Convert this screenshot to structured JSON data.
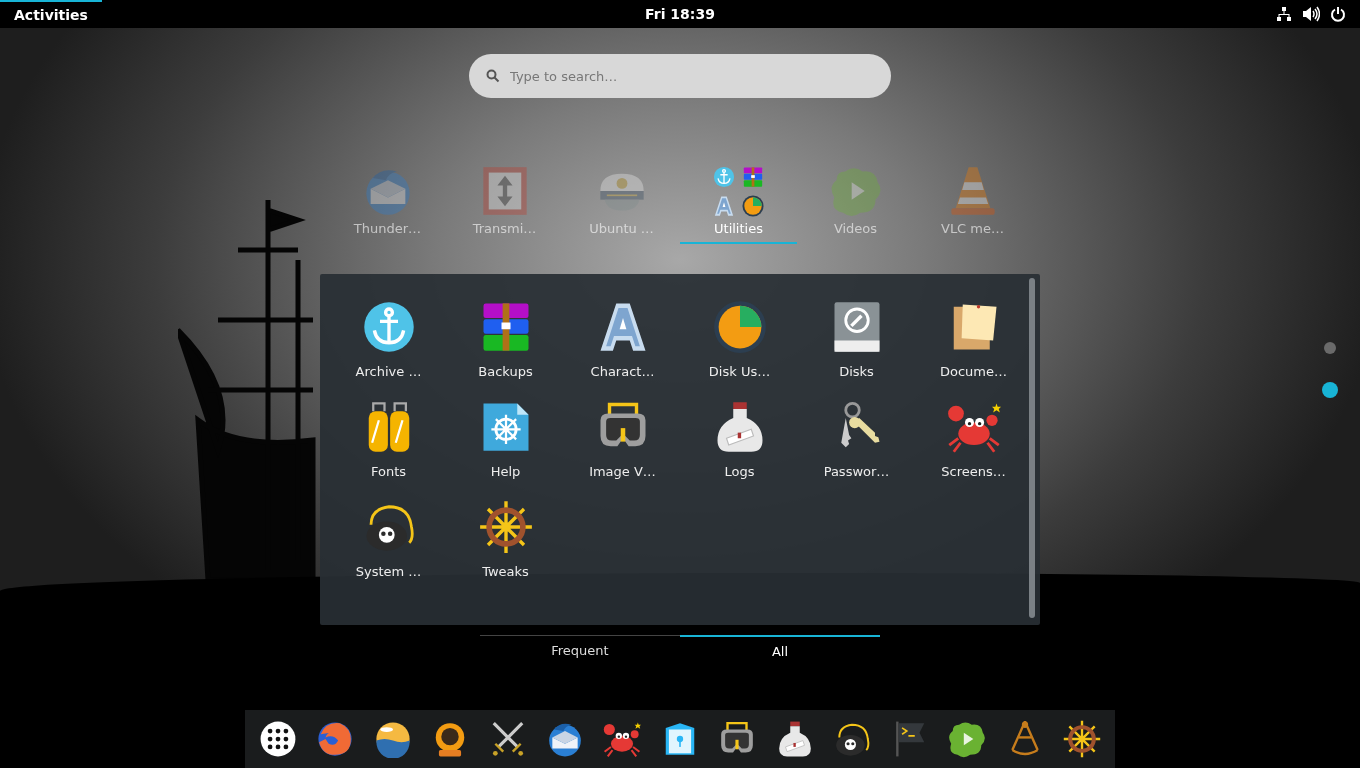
{
  "top_bar": {
    "activities": "Activities",
    "clock": "Fri 18:39"
  },
  "search": {
    "placeholder": "Type to search…"
  },
  "app_row": [
    {
      "label": "Thunder…",
      "selected": false
    },
    {
      "label": "Transmi…",
      "selected": false
    },
    {
      "label": "Ubuntu …",
      "selected": false
    },
    {
      "label": "Utilities",
      "selected": true
    },
    {
      "label": "Videos",
      "selected": false
    },
    {
      "label": "VLC me…",
      "selected": false
    }
  ],
  "folder": {
    "apps": [
      {
        "label": "Archive …"
      },
      {
        "label": "Backups"
      },
      {
        "label": "Charact…"
      },
      {
        "label": "Disk Us…"
      },
      {
        "label": "Disks"
      },
      {
        "label": "Docume…"
      },
      {
        "label": "Fonts"
      },
      {
        "label": "Help"
      },
      {
        "label": "Image V…"
      },
      {
        "label": "Logs"
      },
      {
        "label": "Passwor…"
      },
      {
        "label": "Screens…"
      },
      {
        "label": "System …"
      },
      {
        "label": "Tweaks"
      }
    ]
  },
  "view_tabs": [
    {
      "label": "Frequent",
      "selected": false
    },
    {
      "label": "All",
      "selected": true
    }
  ],
  "pages": [
    {
      "selected": false
    },
    {
      "selected": true
    }
  ]
}
